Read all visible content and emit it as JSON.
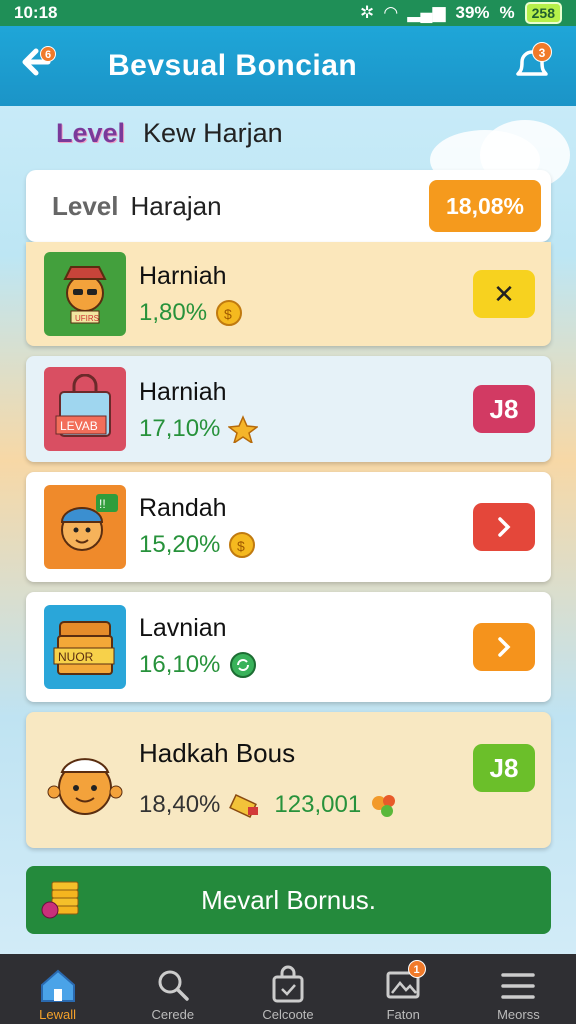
{
  "status_bar": {
    "time": "10:18",
    "signal_percent": "39%",
    "battery_label": "%",
    "battery_value": "258"
  },
  "app_bar": {
    "title": "Bevsual Boncian",
    "back_badge": "6",
    "notification_badge": "3"
  },
  "subheader": {
    "level_word": "Level",
    "title": "Kew Harjan"
  },
  "summary": {
    "level_label": "Level",
    "name": "Harajan",
    "amount": "18,08%"
  },
  "items": [
    {
      "name": "Harniah",
      "percent": "1,80%",
      "thumb_label": "UFIRS",
      "action": "✕",
      "action_color": "#f7d21f",
      "action_text_color": "#222"
    },
    {
      "name": "Harniah",
      "percent": "17,10%",
      "thumb_label": "LEVAB",
      "action": "J8",
      "action_color": "#d23a63",
      "action_text_color": "#fff"
    },
    {
      "name": "Randah",
      "percent": "15,20%",
      "thumb_label": "!!",
      "action": "›",
      "action_color": "#e4473a",
      "action_text_color": "#fff"
    },
    {
      "name": "Lavnian",
      "percent": "16,10%",
      "thumb_label": "NUOR",
      "action": "›",
      "action_color": "#f5931c",
      "action_text_color": "#fff"
    }
  ],
  "bonus_card": {
    "name": "Hadkah Bous",
    "percent": "18,40%",
    "reward": "123,001",
    "action": "J8",
    "action_color": "#6bbf2a"
  },
  "main_button": {
    "label": "Mevarl Bornus."
  },
  "nav": [
    {
      "label": "Lewall",
      "icon": "home-icon",
      "active": true
    },
    {
      "label": "Cerede",
      "icon": "search-icon",
      "active": false
    },
    {
      "label": "Celcoote",
      "icon": "bag-icon",
      "active": false
    },
    {
      "label": "Faton",
      "icon": "image-icon",
      "active": false,
      "badge": "1"
    },
    {
      "label": "Meorss",
      "icon": "menu-icon",
      "active": false
    }
  ],
  "colors": {
    "appbar": "#1fa6d8",
    "status": "#1f8f57",
    "green": "#248a3c",
    "orange": "#f59a1d"
  }
}
